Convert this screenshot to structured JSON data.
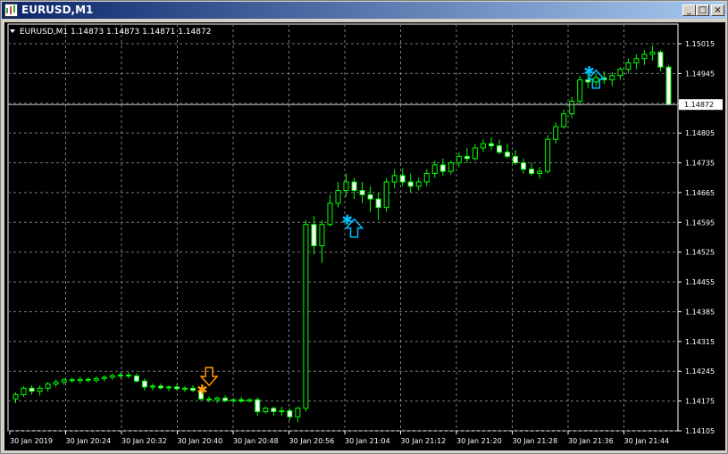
{
  "window": {
    "title": "EURUSD,M1",
    "controls": {
      "minimize": "_",
      "maximize": "□",
      "close": "×"
    }
  },
  "chart": {
    "symbol_info": "EURUSD,M1  1.14873 1.14873 1.14871 1.14872",
    "current_price": "1.14872",
    "price_labels": [
      "1.15015",
      "1.14945",
      "1.14875",
      "1.14805",
      "1.14735",
      "1.14665",
      "1.14595",
      "1.14525",
      "1.14455",
      "1.14385",
      "1.14315",
      "1.14245",
      "1.14175",
      "1.14105"
    ],
    "time_labels": [
      "30 Jan 2019",
      "30 Jan 20:24",
      "30 Jan 20:32",
      "30 Jan 20:40",
      "30 Jan 20:48",
      "30 Jan 20:56",
      "30 Jan 21:04",
      "30 Jan 21:12",
      "30 Jan 21:20",
      "30 Jan 21:28",
      "30 Jan 21:36",
      "30 Jan 21:44"
    ],
    "colors": {
      "background": "#000000",
      "grid": "#7a7a7a",
      "candle": "#00ff00",
      "bull_fill": "#000000",
      "bear_fill": "#ffffff",
      "signal_buy": "#00bfff",
      "signal_sell": "#ff9900"
    }
  },
  "chart_data": {
    "type": "candlestick",
    "symbol": "EURUSD",
    "timeframe": "M1",
    "ylim": [
      1.14105,
      1.15015
    ],
    "candles": [
      [
        1.1418,
        1.14195,
        1.1417,
        1.1419
      ],
      [
        1.1419,
        1.1421,
        1.14185,
        1.14205
      ],
      [
        1.14205,
        1.14212,
        1.1419,
        1.14198
      ],
      [
        1.14198,
        1.14212,
        1.14188,
        1.14205
      ],
      [
        1.14205,
        1.1422,
        1.14198,
        1.14215
      ],
      [
        1.14215,
        1.14225,
        1.14208,
        1.1422
      ],
      [
        1.1422,
        1.14228,
        1.14213,
        1.14225
      ],
      [
        1.14225,
        1.1423,
        1.14218,
        1.14223
      ],
      [
        1.14223,
        1.14232,
        1.14216,
        1.14226
      ],
      [
        1.14226,
        1.14231,
        1.14219,
        1.14224
      ],
      [
        1.14224,
        1.14233,
        1.14218,
        1.14228
      ],
      [
        1.14228,
        1.14236,
        1.14221,
        1.14231
      ],
      [
        1.14231,
        1.1424,
        1.14225,
        1.14235
      ],
      [
        1.14235,
        1.14242,
        1.14228,
        1.14236
      ],
      [
        1.14236,
        1.14243,
        1.14228,
        1.14234
      ],
      [
        1.14234,
        1.1424,
        1.14218,
        1.14222
      ],
      [
        1.14222,
        1.14228,
        1.142,
        1.14208
      ],
      [
        1.14208,
        1.14216,
        1.142,
        1.1421
      ],
      [
        1.1421,
        1.14216,
        1.14202,
        1.14206
      ],
      [
        1.14206,
        1.14212,
        1.14198,
        1.14208
      ],
      [
        1.14208,
        1.14215,
        1.142,
        1.14204
      ],
      [
        1.14204,
        1.1421,
        1.14196,
        1.14205
      ],
      [
        1.14205,
        1.14212,
        1.14196,
        1.142
      ],
      [
        1.142,
        1.14206,
        1.14175,
        1.1418
      ],
      [
        1.1418,
        1.14186,
        1.14172,
        1.14178
      ],
      [
        1.14178,
        1.14186,
        1.1417,
        1.14182
      ],
      [
        1.14182,
        1.14188,
        1.14172,
        1.14176
      ],
      [
        1.14176,
        1.14182,
        1.1417,
        1.14178
      ],
      [
        1.14178,
        1.14185,
        1.1417,
        1.14175
      ],
      [
        1.14175,
        1.14182,
        1.14172,
        1.14178
      ],
      [
        1.14178,
        1.14184,
        1.1414,
        1.1415
      ],
      [
        1.1415,
        1.14162,
        1.14145,
        1.14158
      ],
      [
        1.14158,
        1.14162,
        1.1414,
        1.1415
      ],
      [
        1.1415,
        1.14162,
        1.1414,
        1.14152
      ],
      [
        1.14152,
        1.14158,
        1.1413,
        1.14138
      ],
      [
        1.14138,
        1.14162,
        1.14125,
        1.14158
      ],
      [
        1.14158,
        1.146,
        1.1415,
        1.1459
      ],
      [
        1.1459,
        1.1461,
        1.1452,
        1.1454
      ],
      [
        1.1454,
        1.146,
        1.145,
        1.1459
      ],
      [
        1.1459,
        1.1466,
        1.14585,
        1.1464
      ],
      [
        1.1464,
        1.1469,
        1.1463,
        1.1467
      ],
      [
        1.1467,
        1.1471,
        1.14655,
        1.1469
      ],
      [
        1.1469,
        1.147,
        1.1465,
        1.1467
      ],
      [
        1.1467,
        1.1469,
        1.1464,
        1.1466
      ],
      [
        1.1466,
        1.1468,
        1.1462,
        1.1465
      ],
      [
        1.1465,
        1.14665,
        1.146,
        1.1463
      ],
      [
        1.1463,
        1.147,
        1.1462,
        1.1469
      ],
      [
        1.1469,
        1.1472,
        1.14675,
        1.14705
      ],
      [
        1.14705,
        1.14722,
        1.1468,
        1.1469
      ],
      [
        1.1469,
        1.1471,
        1.14665,
        1.1468
      ],
      [
        1.1468,
        1.147,
        1.1467,
        1.1469
      ],
      [
        1.1469,
        1.1472,
        1.1468,
        1.1471
      ],
      [
        1.1471,
        1.1474,
        1.147,
        1.1473
      ],
      [
        1.1473,
        1.14745,
        1.14705,
        1.14715
      ],
      [
        1.14715,
        1.1474,
        1.14708,
        1.14735
      ],
      [
        1.14735,
        1.1476,
        1.14725,
        1.1475
      ],
      [
        1.1475,
        1.1477,
        1.14735,
        1.14745
      ],
      [
        1.14745,
        1.1478,
        1.1474,
        1.1477
      ],
      [
        1.1477,
        1.1479,
        1.1476,
        1.1478
      ],
      [
        1.1478,
        1.14795,
        1.14765,
        1.14775
      ],
      [
        1.14775,
        1.1479,
        1.14755,
        1.1476
      ],
      [
        1.1476,
        1.1478,
        1.14745,
        1.1475
      ],
      [
        1.1475,
        1.14765,
        1.1473,
        1.14735
      ],
      [
        1.14735,
        1.14745,
        1.1471,
        1.1472
      ],
      [
        1.1472,
        1.14735,
        1.14705,
        1.1471
      ],
      [
        1.1471,
        1.14725,
        1.14698,
        1.14715
      ],
      [
        1.14715,
        1.148,
        1.1471,
        1.1479
      ],
      [
        1.1479,
        1.1483,
        1.1478,
        1.1482
      ],
      [
        1.1482,
        1.1486,
        1.14815,
        1.1485
      ],
      [
        1.1485,
        1.1489,
        1.1484,
        1.1488
      ],
      [
        1.1488,
        1.1494,
        1.1487,
        1.1493
      ],
      [
        1.1493,
        1.14945,
        1.1491,
        1.14925
      ],
      [
        1.14925,
        1.14945,
        1.14915,
        1.14935
      ],
      [
        1.14935,
        1.1495,
        1.1492,
        1.1493
      ],
      [
        1.1493,
        1.14948,
        1.14915,
        1.1494
      ],
      [
        1.1494,
        1.1496,
        1.1493,
        1.14955
      ],
      [
        1.14955,
        1.1498,
        1.14945,
        1.1497
      ],
      [
        1.1497,
        1.1499,
        1.14955,
        1.1498
      ],
      [
        1.1498,
        1.15,
        1.14965,
        1.1499
      ],
      [
        1.1499,
        1.1501,
        1.14975,
        1.14995
      ],
      [
        1.14995,
        1.15,
        1.1495,
        1.1496
      ],
      [
        1.1496,
        1.14965,
        1.1487,
        1.14872
      ]
    ],
    "signals": [
      {
        "type": "sell",
        "candle_index": 24,
        "price": 1.1422
      },
      {
        "type": "buy",
        "candle_index": 42,
        "price": 1.1459
      },
      {
        "type": "buy",
        "candle_index": 72,
        "price": 1.1494
      }
    ]
  }
}
